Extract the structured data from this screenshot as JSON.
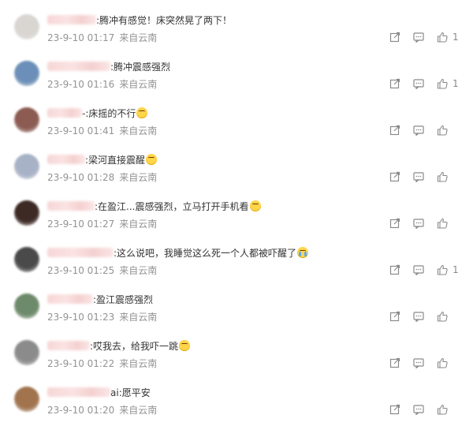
{
  "comments": [
    {
      "name_blur": true,
      "body": ":腾冲有感觉！床突然晃了两下！",
      "emoji": "",
      "time": "23-9-10 01:17",
      "location": "来自云南",
      "likes": "1",
      "avatar_color": "#d9d6d2"
    },
    {
      "name_blur": true,
      "body": ":腾冲震感强烈",
      "emoji": "",
      "time": "23-9-10 01:16",
      "location": "来自云南",
      "likes": "1",
      "avatar_color": "#6b8fb8"
    },
    {
      "name_blur": true,
      "body": "-:床摇的不行",
      "emoji": "grin",
      "time": "23-9-10 01:41",
      "location": "来自云南",
      "likes": "",
      "avatar_color": "#8c5b52"
    },
    {
      "name_blur": true,
      "body": ":梁河直接震醒",
      "emoji": "grin",
      "time": "23-9-10 01:28",
      "location": "来自云南",
      "likes": "",
      "avatar_color": "#a7b2c7"
    },
    {
      "name_blur": true,
      "body": ":在盈江...震感强烈，立马打开手机看",
      "emoji": "grin",
      "time": "23-9-10 01:27",
      "location": "来自云南",
      "likes": "",
      "avatar_color": "#3d2a25"
    },
    {
      "name_blur": true,
      "body": ":这么说吧，我睡觉这么死一个人都被吓醒了",
      "emoji": "cry",
      "time": "23-9-10 01:25",
      "location": "来自云南",
      "likes": "1",
      "avatar_color": "#4a4a4a"
    },
    {
      "name_blur": true,
      "body": ":盈江震感强烈",
      "emoji": "",
      "time": "23-9-10 01:23",
      "location": "来自云南",
      "likes": "",
      "avatar_color": "#6d8a6a"
    },
    {
      "name_blur": true,
      "body": ":哎我去，给我吓一跳",
      "emoji": "grin",
      "time": "23-9-10 01:22",
      "location": "来自云南",
      "likes": "",
      "avatar_color": "#8b8b8b"
    },
    {
      "name_blur": true,
      "body": "ai:愿平安",
      "emoji": "",
      "time": "23-9-10 01:20",
      "location": "来自云南",
      "likes": "",
      "avatar_color": "#a1744e"
    }
  ],
  "icons": {
    "repost": "repost-icon",
    "comment": "comment-icon",
    "like": "like-icon"
  }
}
